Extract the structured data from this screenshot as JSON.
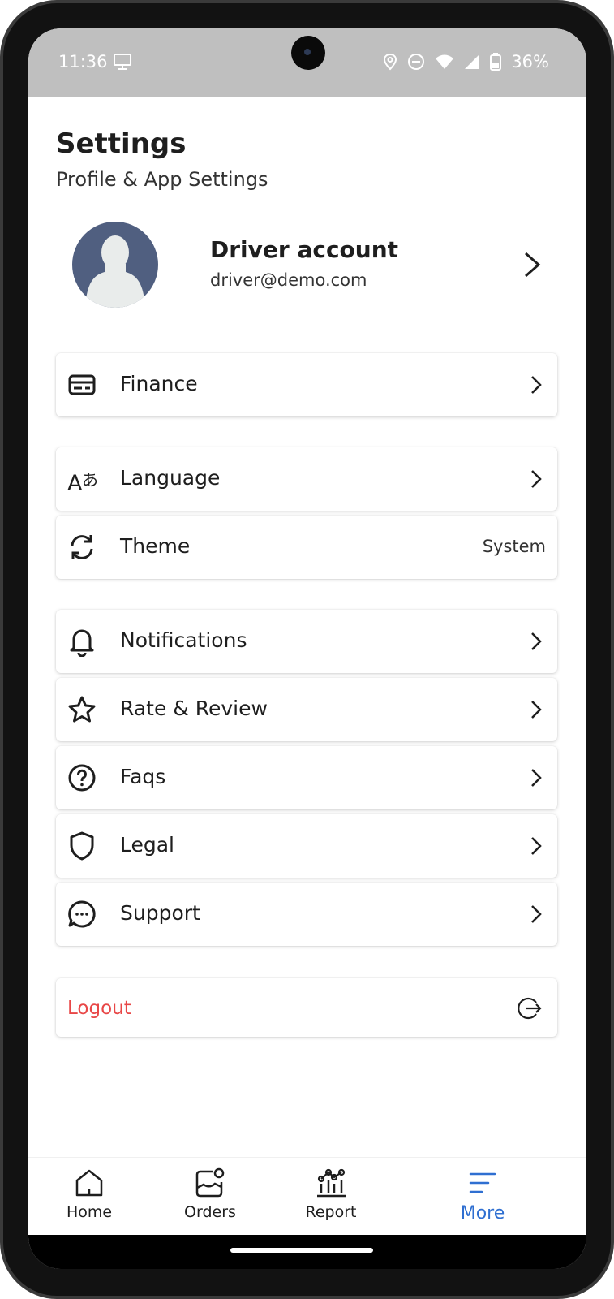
{
  "status_bar": {
    "time": "11:36",
    "battery": "36%",
    "icons": [
      "monitor-icon",
      "location-icon",
      "do-not-disturb-icon",
      "wifi-icon",
      "signal-icon",
      "battery-icon"
    ]
  },
  "header": {
    "title": "Settings",
    "subtitle": "Profile & App Settings"
  },
  "profile": {
    "name": "Driver account",
    "email": "driver@demo.com"
  },
  "menu": {
    "finance": {
      "label": "Finance",
      "icon": "credit-card-icon"
    },
    "language": {
      "label": "Language",
      "icon": "translate-icon"
    },
    "theme": {
      "label": "Theme",
      "value": "System",
      "icon": "refresh-icon"
    },
    "notifications": {
      "label": "Notifications",
      "icon": "bell-icon"
    },
    "rate_review": {
      "label": "Rate & Review",
      "icon": "star-icon"
    },
    "faqs": {
      "label": "Faqs",
      "icon": "help-circle-icon"
    },
    "legal": {
      "label": "Legal",
      "icon": "shield-icon"
    },
    "support": {
      "label": "Support",
      "icon": "chat-icon"
    }
  },
  "logout": {
    "label": "Logout",
    "icon": "logout-icon",
    "color": "#e84747"
  },
  "bottom_nav": {
    "items": [
      {
        "label": "Home",
        "icon": "home-icon"
      },
      {
        "label": "Orders",
        "icon": "orders-icon"
      },
      {
        "label": "Report",
        "icon": "report-icon"
      },
      {
        "label": "More",
        "icon": "menu-icon",
        "active": true
      }
    ],
    "active_color": "#2f6fd1"
  }
}
